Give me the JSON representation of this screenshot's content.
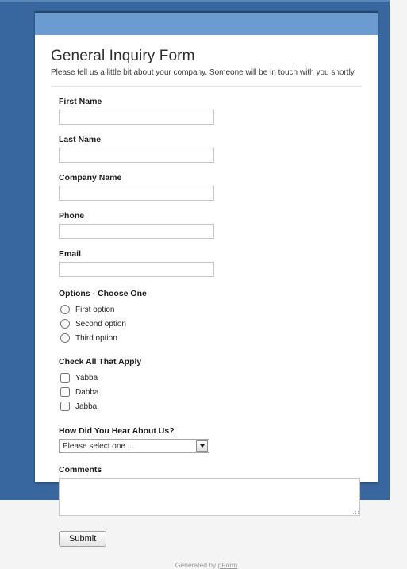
{
  "theme": {
    "frame_blue": "#38679f",
    "header_band_blue": "#6b9bd0",
    "header_band_top": "#21456f",
    "page_background": "#ffffff"
  },
  "form": {
    "title": "General Inquiry Form",
    "subtitle": "Please tell us a little bit about your company. Someone will be in touch with you shortly.",
    "text_fields": [
      {
        "label": "First Name",
        "value": "",
        "placeholder": ""
      },
      {
        "label": "Last Name",
        "value": "",
        "placeholder": ""
      },
      {
        "label": "Company Name",
        "value": "",
        "placeholder": ""
      },
      {
        "label": "Phone",
        "value": "",
        "placeholder": ""
      },
      {
        "label": "Email",
        "value": "",
        "placeholder": ""
      }
    ],
    "radio_group": {
      "label": "Options - Choose One",
      "options": [
        {
          "label": "First option",
          "selected": false
        },
        {
          "label": "Second option",
          "selected": false
        },
        {
          "label": "Third option",
          "selected": false
        }
      ]
    },
    "checkbox_group": {
      "label": "Check All That Apply",
      "options": [
        {
          "label": "Yabba",
          "checked": false
        },
        {
          "label": "Dabba",
          "checked": false
        },
        {
          "label": "Jabba",
          "checked": false
        }
      ]
    },
    "select_field": {
      "label": "How Did You Hear About Us?",
      "selected_value": "Please select one ...",
      "arrow_icon": "chevron-down-icon"
    },
    "comments_field": {
      "label": "Comments",
      "value": "",
      "placeholder": ""
    },
    "submit_label": "Submit",
    "footer": {
      "prefix": "Generated by ",
      "link_text": "pForm"
    }
  }
}
